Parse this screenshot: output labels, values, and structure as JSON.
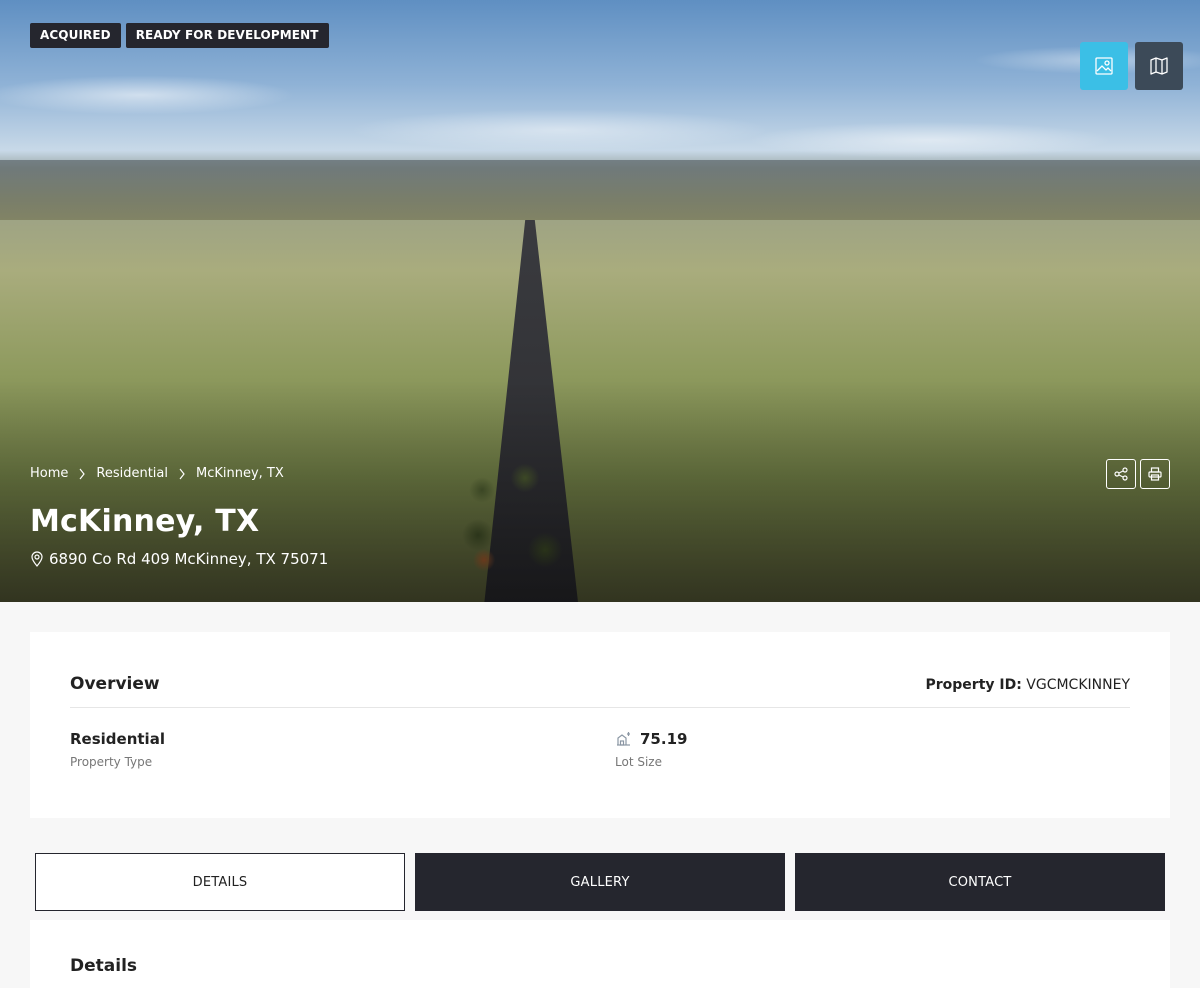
{
  "hero": {
    "badges": [
      "ACQUIRED",
      "READY FOR DEVELOPMENT"
    ],
    "view_buttons": [
      {
        "name": "photo-view",
        "icon": "image-icon",
        "color": "#3bbfe6"
      },
      {
        "name": "map-view",
        "icon": "map-icon",
        "color": "#3c4a58"
      }
    ],
    "breadcrumb": [
      "Home",
      "Residential",
      "McKinney, TX"
    ],
    "title": "McKinney, TX",
    "address": "6890 Co Rd 409 McKinney, TX 75071",
    "tools": [
      {
        "name": "share",
        "icon": "share-icon"
      },
      {
        "name": "print",
        "icon": "print-icon"
      }
    ]
  },
  "overview": {
    "title": "Overview",
    "property_id_label": "Property ID:",
    "property_id_value": "VGCMCKINNEY",
    "property_type_value": "Residential",
    "property_type_label": "Property Type",
    "lot_size_value": "75.19",
    "lot_size_label": "Lot Size"
  },
  "tabs": [
    "DETAILS",
    "GALLERY",
    "CONTACT"
  ],
  "details": {
    "title": "Details"
  },
  "colors": {
    "dark": "#25262e",
    "accent": "#3bbfe6",
    "map_button": "#3c4a58"
  }
}
